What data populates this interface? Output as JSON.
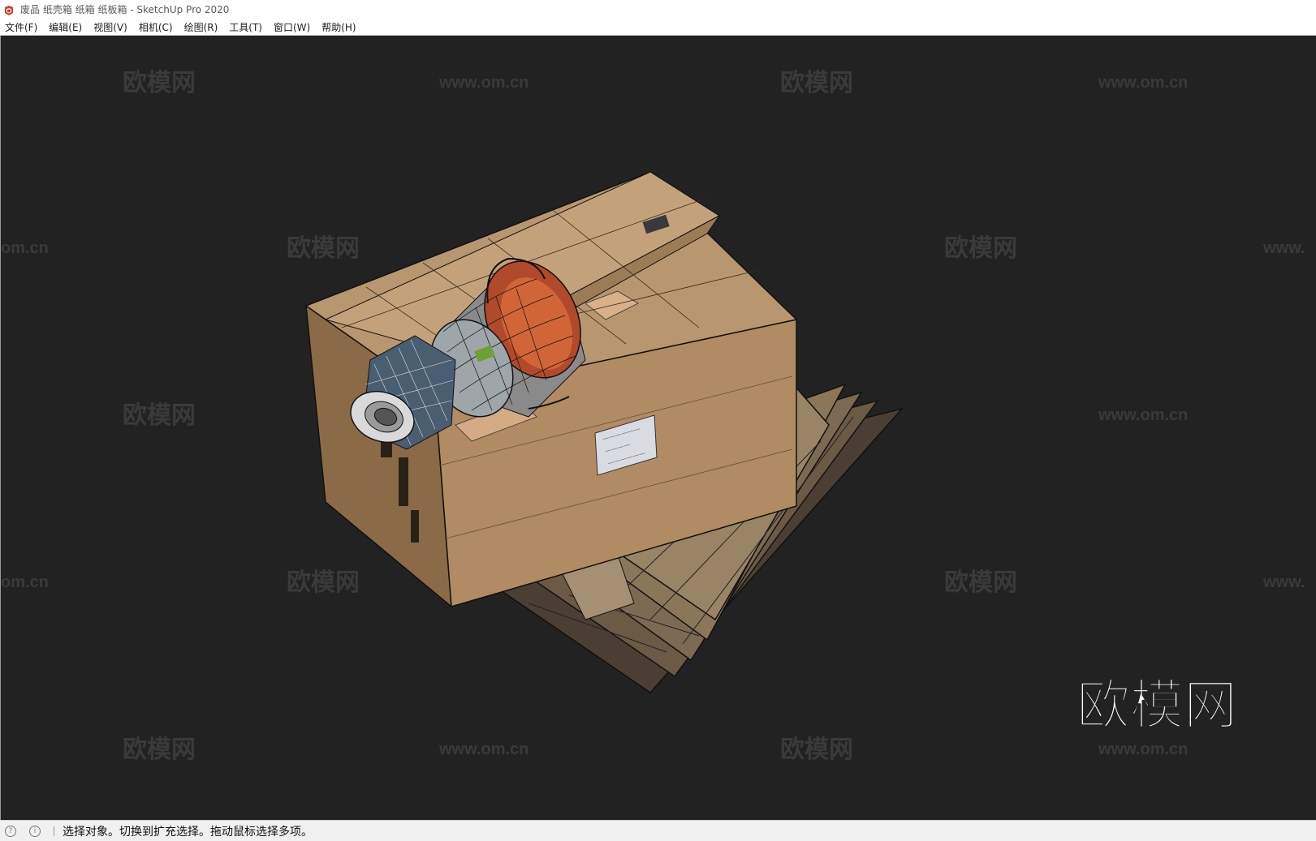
{
  "window": {
    "title": "废品 纸壳箱 纸箱 纸板箱 - SketchUp Pro 2020",
    "app_icon": "sketchup-icon",
    "accent_color": "#d83b2a"
  },
  "menu": {
    "items": [
      {
        "label": "文件(F)"
      },
      {
        "label": "编辑(E)"
      },
      {
        "label": "视图(V)"
      },
      {
        "label": "相机(C)"
      },
      {
        "label": "绘图(R)"
      },
      {
        "label": "工具(T)"
      },
      {
        "label": "窗口(W)"
      },
      {
        "label": "帮助(H)"
      }
    ]
  },
  "viewport": {
    "background_color": "#222222",
    "model": "cardboard box with paint bucket and tape roll on flattened cardboard sheets",
    "watermark_text_cn": "欧模网",
    "watermark_text_url": "www.om.cn",
    "partial_watermark_url": "om.cn",
    "partial_watermark_www": "www.",
    "label_lines": [
      "——————",
      "————",
      "——————"
    ],
    "brand_logo_text": "欧模网",
    "brand_logo_url": "www.om.cn"
  },
  "status": {
    "icon_1": "geo-location-icon",
    "icon_2": "info-icon",
    "icon_2_glyph": "i",
    "icon_1_glyph": "?",
    "text": "选择对象。切换到扩充选择。拖动鼠标选择多项。"
  }
}
